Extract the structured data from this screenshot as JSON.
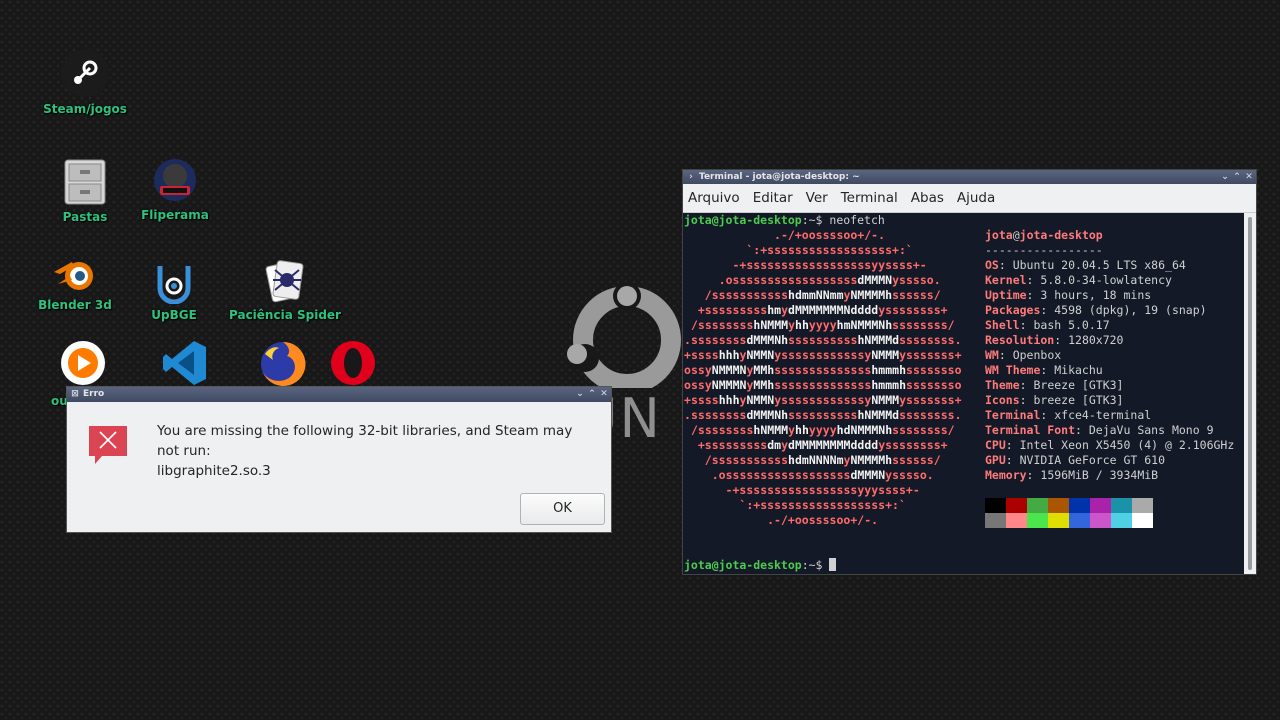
{
  "desktop": {
    "wallpaper_text": "UN",
    "icons": [
      {
        "label": "Steam/jogos"
      },
      {
        "label": "Pastas"
      },
      {
        "label": "Fliperama"
      },
      {
        "label": "Blender 3d"
      },
      {
        "label": "UpBGE"
      },
      {
        "label": "Paciência Spider"
      },
      {
        "label": "ou"
      }
    ]
  },
  "dialog": {
    "title": "Erro",
    "message_line1": "You are missing the following 32-bit libraries, and Steam may not run:",
    "message_line2": "libgraphite2.so.3",
    "ok_label": "OK"
  },
  "terminal": {
    "title": "Terminal - jota@jota-desktop: ~",
    "menu": [
      "Arquivo",
      "Editar",
      "Ver",
      "Terminal",
      "Abas",
      "Ajuda"
    ],
    "prompt_user": "jota@jota-desktop",
    "prompt_path": ":~$",
    "command": " neofetch",
    "ascii_art": [
      "             .-/+oossssoo+/-.",
      "         `:+ssssssssssssssssss+:`",
      "       -+ssssssssssssssssssyyssss+-",
      "     .ossssssssssssssssssdMMMNysssso.",
      "   /ssssssssssshdmmNNmmyNMMMMhssssss/",
      "  +ssssssssshmydMMMMMMMNddddyssssssss+",
      " /sssssssshNMMMyhhyyyyhmNMMMNhssssssss/",
      ".ssssssssdMMMNhsssssssssshNMMMdssssssss.",
      "+sssshhhyNMMNyssssssssssssyNMMMysssssss+",
      "ossyNMMMNyMMhsssssssssssssshmmmhssssssso",
      "ossyNMMMNyMMhsssssssssssssshmmmhssssssso",
      "+sssshhhyNMMNyssssssssssssyNMMMysssssss+",
      ".ssssssssdMMMNhsssssssssshNMMMdssssssss.",
      " /sssssssshNMMMyhhyyyyhdNMMMNhssssssss/",
      "  +sssssssssdmydMMMMMMMMddddyssssssss+",
      "   /ssssssssssshdmNNNNmyNMMMMhssssss/",
      "    .ossssssssssssssssssdMMMNysssso.",
      "      -+sssssssssssssssssyyyssss+-",
      "        `:+ssssssssssssssssss+:`",
      "            .-/+oossssoo+/-."
    ],
    "info_user": "jota",
    "info_at": "@",
    "info_host": "jota-desktop",
    "info_sep": "-----------------",
    "info": [
      {
        "key": "OS",
        "value": ": Ubuntu 20.04.5 LTS x86_64"
      },
      {
        "key": "Kernel",
        "value": ": 5.8.0-34-lowlatency"
      },
      {
        "key": "Uptime",
        "value": ": 3 hours, 18 mins"
      },
      {
        "key": "Packages",
        "value": ": 4598 (dpkg), 19 (snap)"
      },
      {
        "key": "Shell",
        "value": ": bash 5.0.17"
      },
      {
        "key": "Resolution",
        "value": ": 1280x720"
      },
      {
        "key": "WM",
        "value": ": Openbox"
      },
      {
        "key": "WM Theme",
        "value": ": Mikachu"
      },
      {
        "key": "Theme",
        "value": ": Breeze [GTK3]"
      },
      {
        "key": "Icons",
        "value": ": breeze [GTK3]"
      },
      {
        "key": "Terminal",
        "value": ": xfce4-terminal"
      },
      {
        "key": "Terminal Font",
        "value": ": DejaVu Sans Mono 9"
      },
      {
        "key": "CPU",
        "value": ": Intel Xeon X5450 (4) @ 2.106GHz"
      },
      {
        "key": "GPU",
        "value": ": NVIDIA GeForce GT 610"
      },
      {
        "key": "Memory",
        "value": ": 1596MiB / 3934MiB"
      }
    ],
    "palette_row1": [
      "#000000",
      "#aa0000",
      "#44aa44",
      "#aa5500",
      "#0033aa",
      "#aa22aa",
      "#1a92aa",
      "#aaaaaa"
    ],
    "palette_row2": [
      "#777777",
      "#ff8787",
      "#4ce64c",
      "#dede00",
      "#3366dd",
      "#cc55cc",
      "#4fd0e5",
      "#ffffff"
    ]
  }
}
